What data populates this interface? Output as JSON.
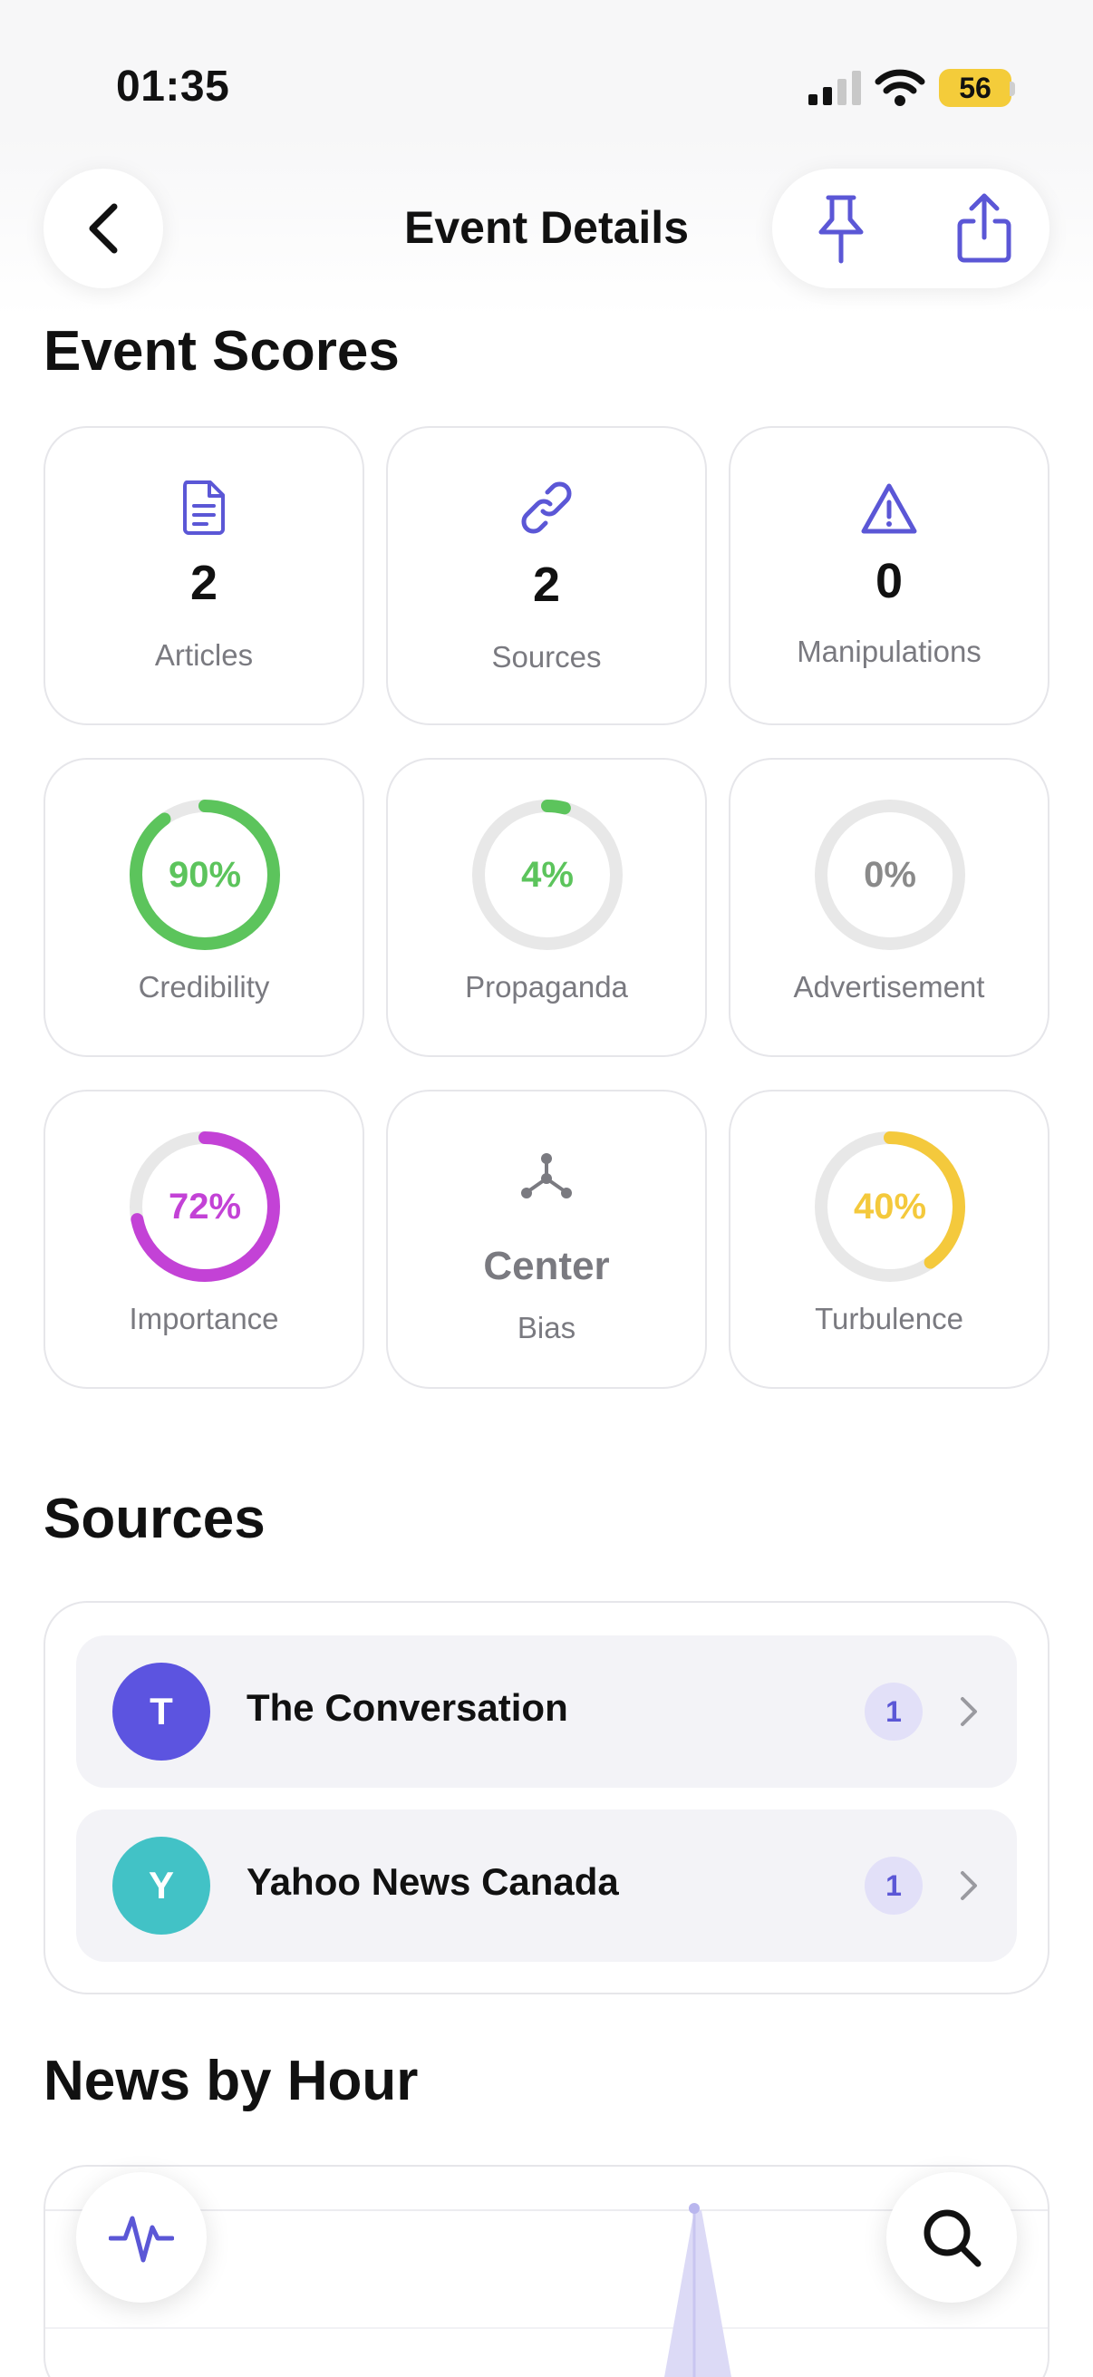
{
  "status_bar": {
    "time": "01:35",
    "battery": "56"
  },
  "header": {
    "title": "Event Details"
  },
  "scores": {
    "title": "Event Scores",
    "articles": {
      "value": "2",
      "label": "Articles"
    },
    "sources": {
      "value": "2",
      "label": "Sources"
    },
    "manipulations": {
      "value": "0",
      "label": "Manipulations"
    },
    "credibility": {
      "value": "90%",
      "label": "Credibility",
      "percent": 90,
      "color": "#5cc45c"
    },
    "propaganda": {
      "value": "4%",
      "label": "Propaganda",
      "percent": 4,
      "color": "#5cc45c"
    },
    "advertisement": {
      "value": "0%",
      "label": "Advertisement",
      "percent": 0,
      "color": "#8a8a8a"
    },
    "importance": {
      "value": "72%",
      "label": "Importance",
      "percent": 72,
      "color": "#c342d6"
    },
    "bias": {
      "value": "Center",
      "label": "Bias"
    },
    "turbulence": {
      "value": "40%",
      "label": "Turbulence",
      "percent": 40,
      "color": "#f4c93c"
    }
  },
  "sources_section": {
    "title": "Sources",
    "items": [
      {
        "initial": "T",
        "name": "The Conversation",
        "count": "1",
        "color": "#5c54e0"
      },
      {
        "initial": "Y",
        "name": "Yahoo News Canada",
        "count": "1",
        "color": "#42c2c6"
      }
    ]
  },
  "news_by_hour": {
    "title": "News by Hour"
  },
  "colors": {
    "accent": "#5b57d6",
    "ring_track": "#e8e8e8"
  }
}
